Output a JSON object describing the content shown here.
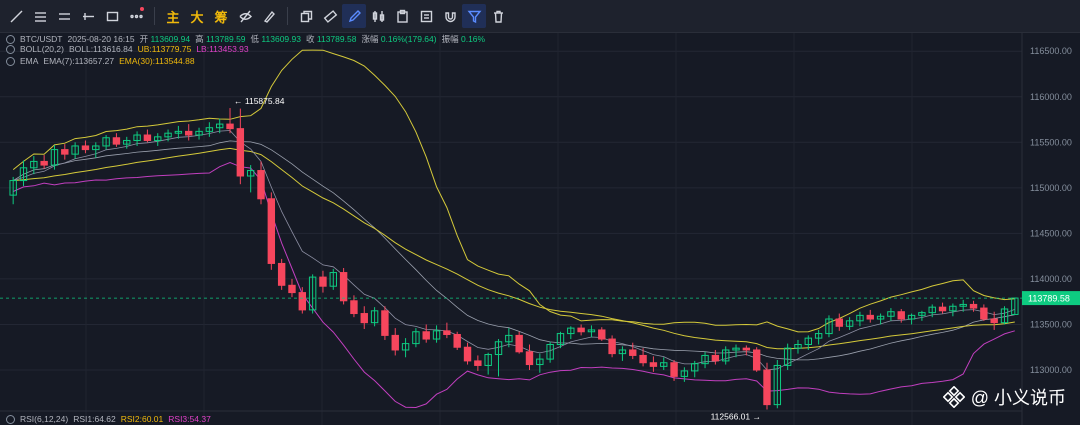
{
  "toolbar": {
    "tools": [
      {
        "name": "trendline-icon",
        "kind": "svg"
      },
      {
        "name": "horizontal-lines-icon",
        "kind": "svg"
      },
      {
        "name": "parallel-lines-icon",
        "kind": "svg"
      },
      {
        "name": "cross-line-icon",
        "kind": "svg"
      },
      {
        "name": "rectangle-icon",
        "kind": "svg"
      },
      {
        "name": "more-icon",
        "kind": "svg"
      }
    ],
    "text_buttons": [
      "主",
      "大",
      "筹"
    ]
  },
  "header": {
    "pair": "BTC/USDT",
    "datetime": "2025-08-20 16:15",
    "open_label": "开",
    "open": "113609.94",
    "high_label": "高",
    "high": "113789.59",
    "low_label": "低",
    "low": "113609.93",
    "close_label": "收",
    "close": "113789.58",
    "change_label": "涨幅",
    "change": "0.16%(179.64)",
    "amplitude_label": "振幅",
    "amplitude": "0.16%"
  },
  "boll": {
    "name": "BOLL(20,2)",
    "boll": "BOLL:113616.84",
    "ub": "UB:113779.75",
    "lb": "LB:113453.93"
  },
  "ema": {
    "name": "EMA",
    "ema7": "EMA(7):113657.27",
    "ema30": "EMA(30):113544.88"
  },
  "rsi": {
    "name": "RSI(6,12,24)",
    "rsi1": "RSI1:64.62",
    "rsi2": "RSI2:60.01",
    "rsi3": "RSI3:54.37"
  },
  "watermark": "@ 小义说币",
  "chart_data": {
    "type": "candlestick",
    "y_ticks": [
      "116500.00",
      "116000.00",
      "115500.00",
      "115000.00",
      "114500.00",
      "114000.00",
      "113500.00",
      "113000.00"
    ],
    "ylim": [
      112550,
      116700
    ],
    "current_price_label": "113789.58",
    "high_annotation": "115875.84",
    "low_annotation": "112566.01",
    "candles": [
      [
        114920,
        115120,
        114820,
        115080
      ],
      [
        115080,
        115300,
        115020,
        115220
      ],
      [
        115220,
        115350,
        115150,
        115290
      ],
      [
        115290,
        115360,
        115210,
        115250
      ],
      [
        115250,
        115470,
        115200,
        115420
      ],
      [
        115420,
        115480,
        115310,
        115370
      ],
      [
        115370,
        115500,
        115320,
        115460
      ],
      [
        115460,
        115520,
        115380,
        115420
      ],
      [
        115420,
        115500,
        115330,
        115460
      ],
      [
        115460,
        115580,
        115420,
        115550
      ],
      [
        115550,
        115600,
        115450,
        115480
      ],
      [
        115480,
        115560,
        115430,
        115520
      ],
      [
        115520,
        115620,
        115460,
        115580
      ],
      [
        115580,
        115640,
        115500,
        115520
      ],
      [
        115520,
        115600,
        115460,
        115560
      ],
      [
        115560,
        115640,
        115510,
        115600
      ],
      [
        115600,
        115680,
        115540,
        115620
      ],
      [
        115620,
        115700,
        115520,
        115580
      ],
      [
        115580,
        115660,
        115530,
        115620
      ],
      [
        115620,
        115720,
        115560,
        115660
      ],
      [
        115660,
        115760,
        115600,
        115700
      ],
      [
        115700,
        115876,
        115600,
        115650
      ],
      [
        115650,
        115870,
        115040,
        115130
      ],
      [
        115130,
        115250,
        114950,
        115190
      ],
      [
        115190,
        115290,
        114820,
        114880
      ],
      [
        114880,
        114950,
        114100,
        114170
      ],
      [
        114170,
        114220,
        113880,
        113930
      ],
      [
        113930,
        114000,
        113800,
        113850
      ],
      [
        113850,
        113910,
        113620,
        113660
      ],
      [
        113660,
        114050,
        113620,
        114020
      ],
      [
        114020,
        114090,
        113850,
        113920
      ],
      [
        113920,
        114110,
        113880,
        114070
      ],
      [
        114070,
        114120,
        113720,
        113760
      ],
      [
        113760,
        113820,
        113580,
        113620
      ],
      [
        113620,
        113700,
        113450,
        113520
      ],
      [
        113520,
        113690,
        113480,
        113650
      ],
      [
        113650,
        113700,
        113330,
        113380
      ],
      [
        113380,
        113460,
        113160,
        113220
      ],
      [
        113220,
        113350,
        113140,
        113290
      ],
      [
        113290,
        113460,
        113250,
        113420
      ],
      [
        113420,
        113500,
        113300,
        113340
      ],
      [
        113340,
        113490,
        113300,
        113430
      ],
      [
        113430,
        113520,
        113350,
        113390
      ],
      [
        113390,
        113420,
        113220,
        113250
      ],
      [
        113250,
        113300,
        113060,
        113100
      ],
      [
        113100,
        113160,
        112990,
        113050
      ],
      [
        113050,
        113190,
        112950,
        113170
      ],
      [
        113170,
        113340,
        112930,
        113310
      ],
      [
        113310,
        113460,
        113250,
        113380
      ],
      [
        113380,
        113420,
        113180,
        113200
      ],
      [
        113200,
        113280,
        113000,
        113060
      ],
      [
        113060,
        113180,
        112970,
        113120
      ],
      [
        113120,
        113310,
        113080,
        113280
      ],
      [
        113280,
        113420,
        113240,
        113400
      ],
      [
        113400,
        113480,
        113340,
        113460
      ],
      [
        113460,
        113500,
        113380,
        113420
      ],
      [
        113420,
        113490,
        113360,
        113440
      ],
      [
        113440,
        113470,
        113320,
        113340
      ],
      [
        113340,
        113380,
        113140,
        113180
      ],
      [
        113180,
        113260,
        113100,
        113220
      ],
      [
        113220,
        113300,
        113120,
        113160
      ],
      [
        113160,
        113240,
        113040,
        113080
      ],
      [
        113080,
        113150,
        112980,
        113040
      ],
      [
        113040,
        113140,
        113000,
        113080
      ],
      [
        113080,
        113110,
        112880,
        112930
      ],
      [
        112930,
        113030,
        112870,
        112990
      ],
      [
        112990,
        113100,
        112920,
        113070
      ],
      [
        113070,
        113200,
        113020,
        113160
      ],
      [
        113160,
        113220,
        113060,
        113100
      ],
      [
        113100,
        113260,
        113060,
        113220
      ],
      [
        113220,
        113280,
        113140,
        113240
      ],
      [
        113240,
        113270,
        113160,
        113220
      ],
      [
        113220,
        113250,
        112980,
        113000
      ],
      [
        113000,
        113080,
        112566,
        112620
      ],
      [
        112620,
        113110,
        112580,
        113050
      ],
      [
        113050,
        113290,
        113000,
        113240
      ],
      [
        113240,
        113330,
        113180,
        113280
      ],
      [
        113280,
        113380,
        113220,
        113350
      ],
      [
        113350,
        113440,
        113280,
        113400
      ],
      [
        113400,
        113600,
        113360,
        113560
      ],
      [
        113560,
        113620,
        113430,
        113480
      ],
      [
        113480,
        113580,
        113440,
        113540
      ],
      [
        113540,
        113640,
        113480,
        113600
      ],
      [
        113600,
        113660,
        113520,
        113560
      ],
      [
        113560,
        113620,
        113500,
        113590
      ],
      [
        113590,
        113680,
        113540,
        113640
      ],
      [
        113640,
        113670,
        113520,
        113560
      ],
      [
        113560,
        113620,
        113500,
        113600
      ],
      [
        113600,
        113650,
        113540,
        113630
      ],
      [
        113630,
        113720,
        113580,
        113690
      ],
      [
        113690,
        113740,
        113620,
        113650
      ],
      [
        113650,
        113730,
        113590,
        113700
      ],
      [
        113700,
        113770,
        113640,
        113720
      ],
      [
        113720,
        113760,
        113640,
        113680
      ],
      [
        113680,
        113720,
        113540,
        113560
      ],
      [
        113560,
        113640,
        113440,
        113520
      ],
      [
        113520,
        113700,
        113500,
        113670
      ],
      [
        113610,
        113790,
        113610,
        113790
      ]
    ]
  }
}
